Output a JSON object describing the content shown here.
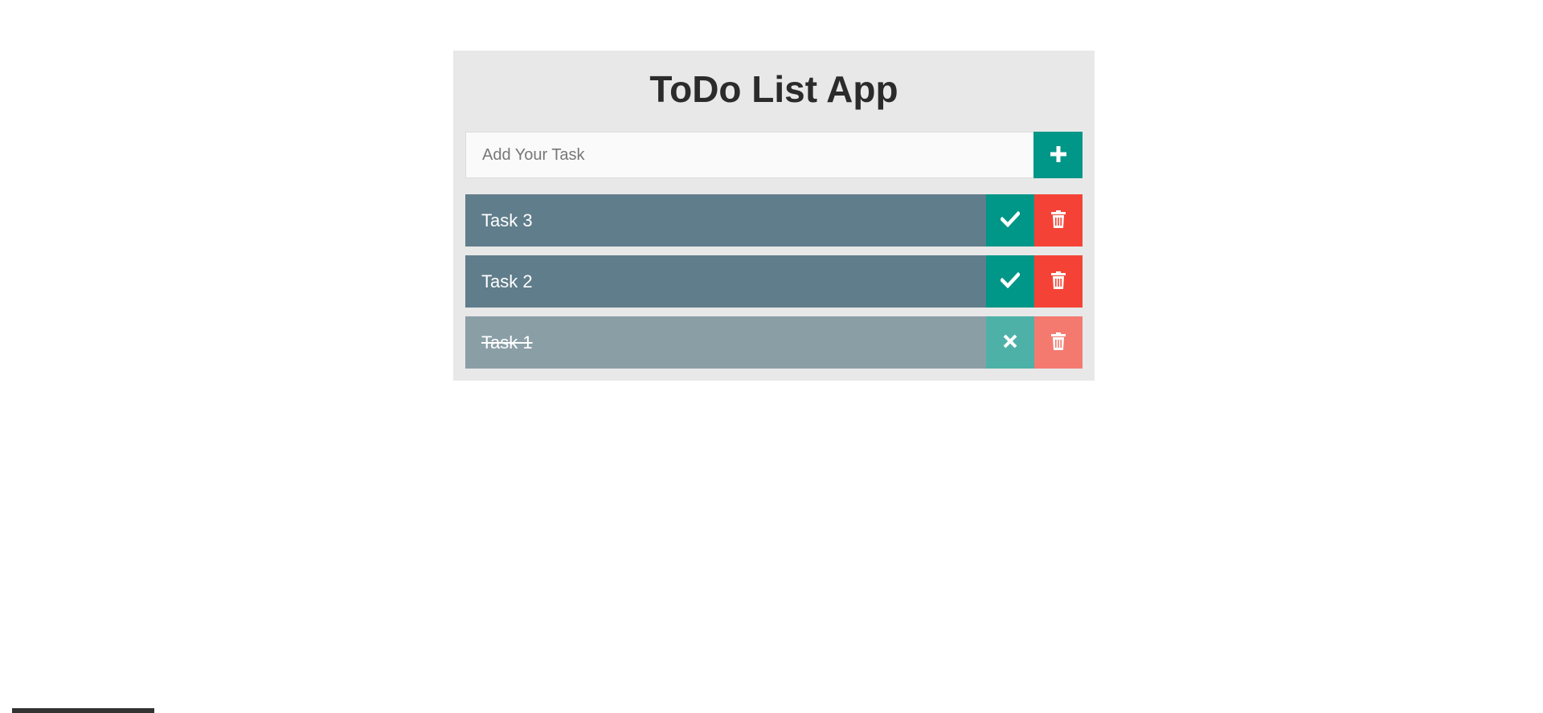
{
  "app": {
    "title": "ToDo List App"
  },
  "input": {
    "placeholder": "Add Your Task",
    "value": "",
    "add_icon": "plus-icon"
  },
  "tasks": [
    {
      "label": "Task 3",
      "completed": false,
      "toggle_icon": "check-icon",
      "delete_icon": "trash-icon"
    },
    {
      "label": "Task 2",
      "completed": false,
      "toggle_icon": "check-icon",
      "delete_icon": "trash-icon"
    },
    {
      "label": "Task 1",
      "completed": true,
      "toggle_icon": "close-icon",
      "delete_icon": "trash-icon"
    }
  ],
  "colors": {
    "accent": "#009688",
    "danger": "#f44336",
    "task_bg": "#607d8b",
    "task_done_bg": "#8a9ea6",
    "panel_bg": "#e8e8e8"
  }
}
